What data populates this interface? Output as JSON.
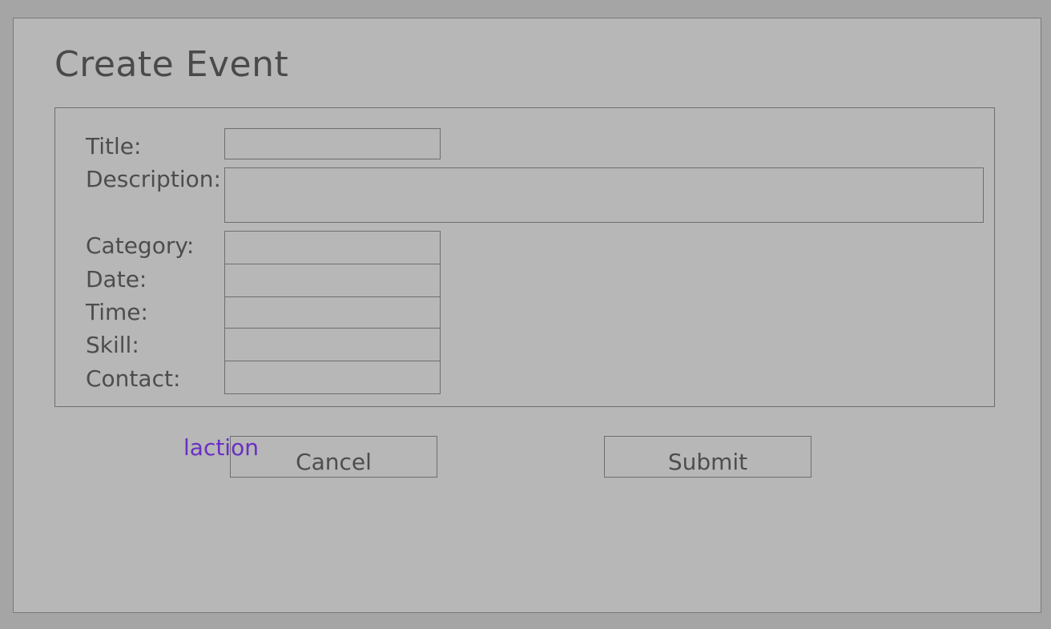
{
  "page": {
    "title": "Create Event"
  },
  "form": {
    "fields": {
      "title": {
        "label": "Title:",
        "value": ""
      },
      "description": {
        "label": "Description:",
        "value": ""
      },
      "category": {
        "label": "Category:",
        "value": ""
      },
      "date": {
        "label": "Date:",
        "value": ""
      },
      "time": {
        "label": "Time:",
        "value": ""
      },
      "skill": {
        "label": "Skill:",
        "value": ""
      },
      "contact": {
        "label": "Contact:",
        "value": ""
      }
    }
  },
  "actions": {
    "cancel_label": "Cancel",
    "submit_label": "Submit"
  },
  "overlay": {
    "stray_text": "laction",
    "stray_text_color": "#6a2fc4"
  },
  "colors": {
    "backdrop": "#a5a5a5",
    "window": "#b7b7b7",
    "border": "#6e6e6e",
    "text": "#4d4d4d"
  }
}
